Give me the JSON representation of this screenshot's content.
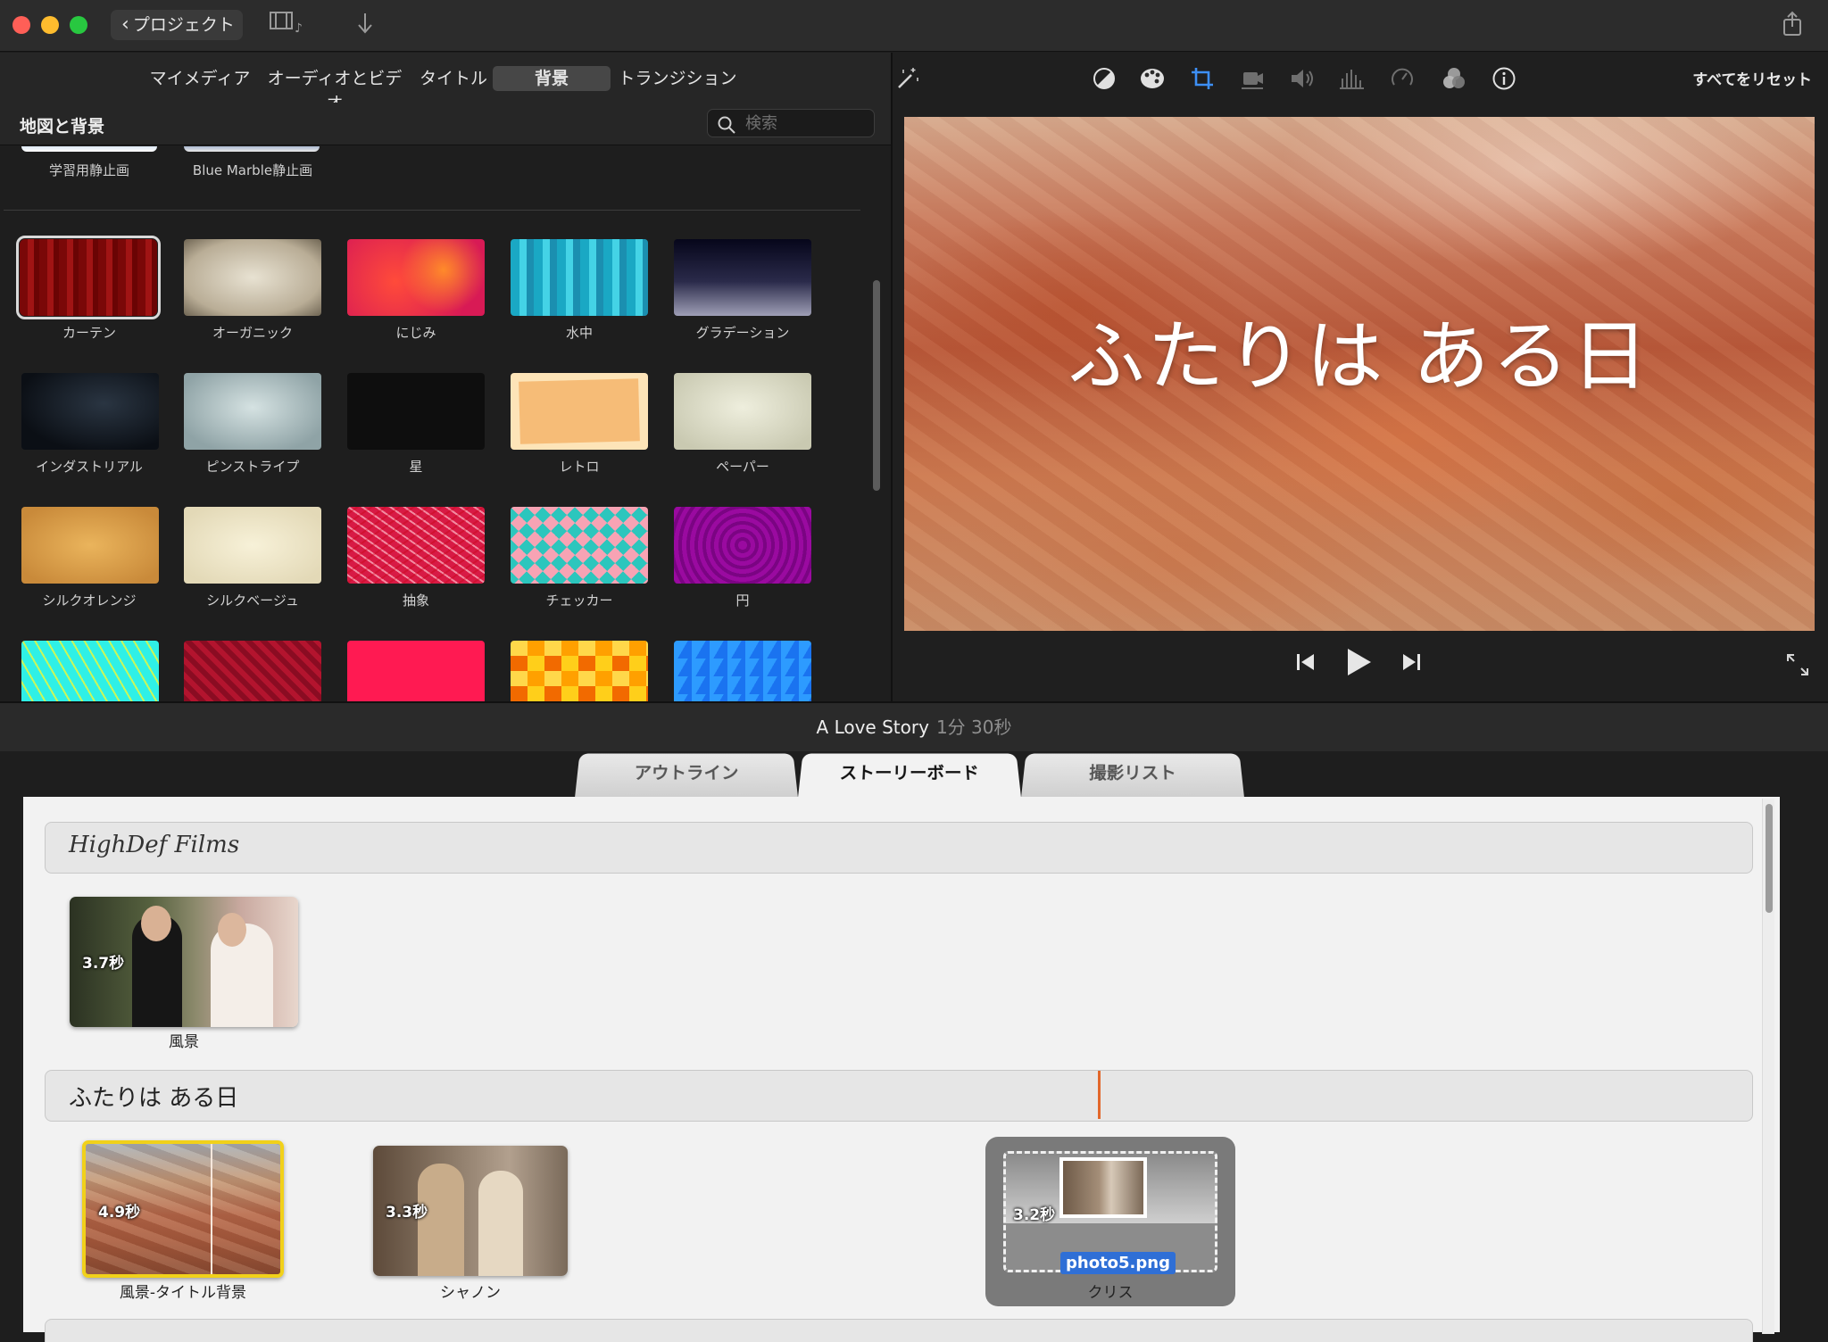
{
  "titlebar": {
    "project_button": "プロジェクト"
  },
  "browser_tabs": [
    {
      "label": "マイメディア"
    },
    {
      "label": "オーディオとビデオ"
    },
    {
      "label": "タイトル"
    },
    {
      "label": "背景",
      "active": true
    },
    {
      "label": "トランジション"
    }
  ],
  "library": {
    "title": "地図と背景",
    "search_placeholder": "検索",
    "categories": [
      "学習用静止画",
      "Blue Marble静止画"
    ],
    "backgrounds": [
      {
        "label": "カーテン",
        "selected": true
      },
      {
        "label": "オーガニック"
      },
      {
        "label": "にじみ"
      },
      {
        "label": "水中"
      },
      {
        "label": "グラデーション"
      },
      {
        "label": "インダストリアル"
      },
      {
        "label": "ピンストライプ"
      },
      {
        "label": "星"
      },
      {
        "label": "レトロ"
      },
      {
        "label": "ペーパー"
      },
      {
        "label": "シルクオレンジ"
      },
      {
        "label": "シルクベージュ"
      },
      {
        "label": "抽象"
      },
      {
        "label": "チェッカー"
      },
      {
        "label": "円"
      }
    ]
  },
  "viewer": {
    "reset_all": "すべてをリセット",
    "preview_title": "ふたりは ある日"
  },
  "project": {
    "name": "A Love Story",
    "duration": "1分 30秒"
  },
  "storyboard_tabs": [
    {
      "label": "アウトライン"
    },
    {
      "label": "ストーリーボード",
      "active": true
    },
    {
      "label": "撮影リスト"
    }
  ],
  "storyboard": {
    "section1_title": "HighDef Films",
    "section2_title": "ふたりは ある日",
    "clips": [
      {
        "duration": "3.7秒",
        "label": "風景"
      },
      {
        "duration": "4.9秒",
        "label": "風景-タイトル背景"
      },
      {
        "duration": "3.3秒",
        "label": "シャノン"
      },
      {
        "duration": "3.2秒",
        "label": "クリス",
        "filename": "photo5.png"
      }
    ]
  },
  "colors": {
    "accent_blue": "#2f6fd6",
    "selection_yellow": "#f1d11a",
    "playhead_orange": "#e2672a"
  }
}
